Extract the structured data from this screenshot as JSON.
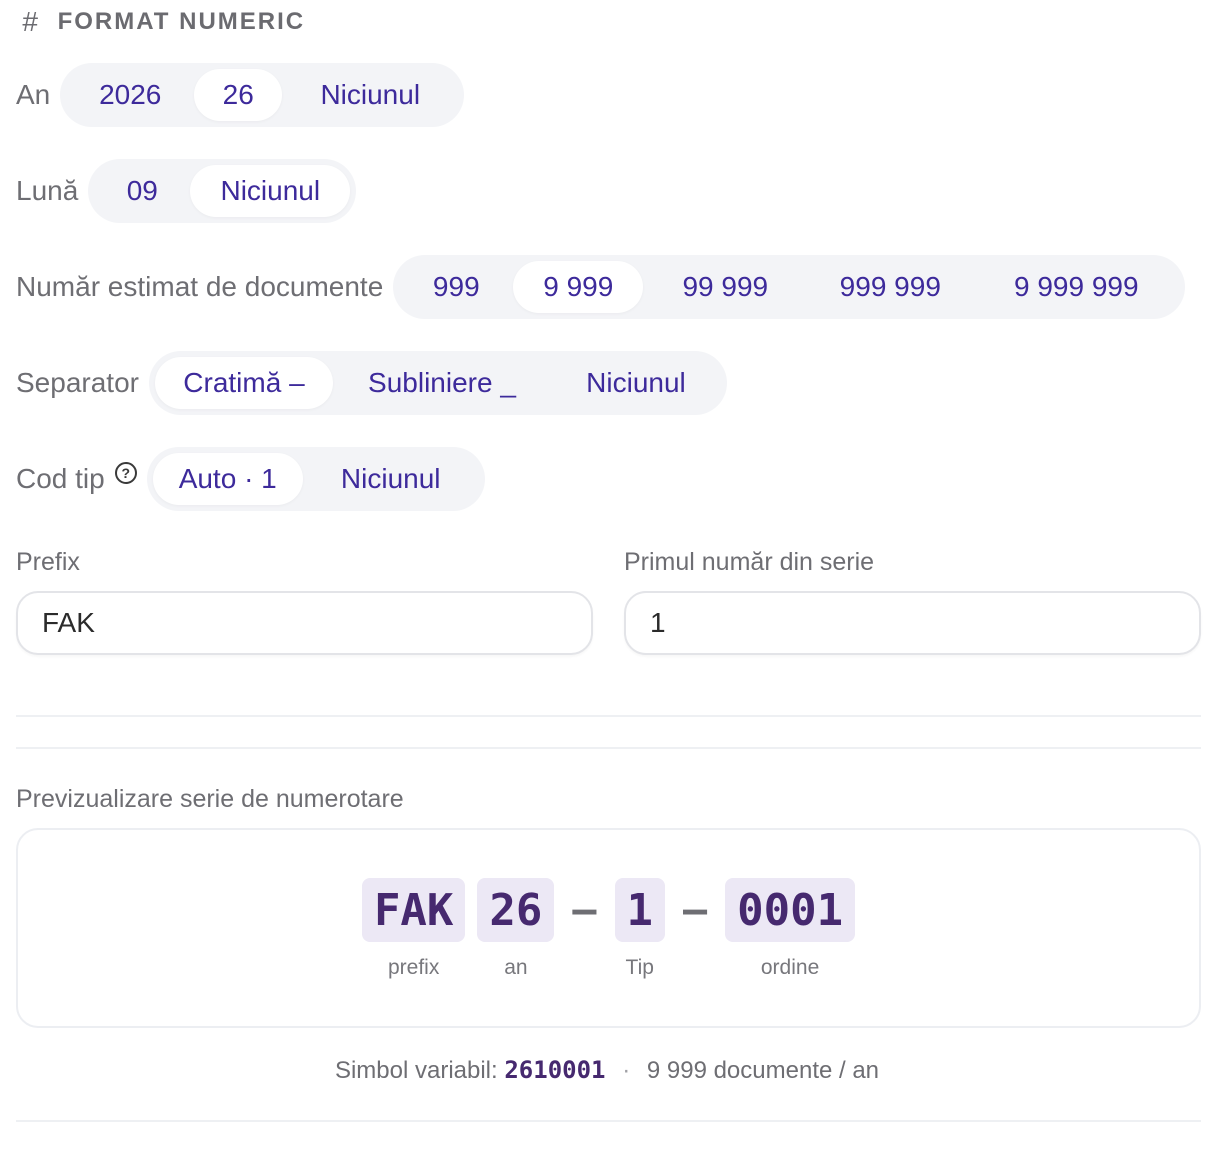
{
  "section": {
    "icon": "hash-icon",
    "glyph": "#",
    "title": "FORMAT NUMERIC"
  },
  "year": {
    "label": "An",
    "options": [
      "2026",
      "26",
      "Niciunul"
    ],
    "selected": "26"
  },
  "month": {
    "label": "Lună",
    "options": [
      "09",
      "Niciunul"
    ],
    "selected": "Niciunul"
  },
  "doc_count": {
    "label": "Număr estimat de documente",
    "options": [
      "999",
      "9 999",
      "99 999",
      "999 999",
      "9 999 999"
    ],
    "selected": "9 999"
  },
  "separator": {
    "label": "Separator",
    "options": [
      "Cratimă –",
      "Subliniere _",
      "Niciunul"
    ],
    "selected": "Cratimă –"
  },
  "type_code": {
    "label": "Cod tip",
    "help_icon": "question-circle-icon",
    "help_glyph": "?",
    "options": [
      "Auto · 1",
      "Niciunul"
    ],
    "selected": "Auto · 1"
  },
  "prefix": {
    "label": "Prefix",
    "value": "FAK"
  },
  "first_number": {
    "label": "Primul număr din serie",
    "value": "1"
  },
  "preview": {
    "label": "Previzualizare serie de numerotare",
    "tokens": [
      {
        "value": "FAK",
        "caption": "prefix"
      },
      {
        "value": "26",
        "caption": "an"
      },
      {
        "value": "–",
        "separator": true
      },
      {
        "value": "1",
        "caption": "Tip"
      },
      {
        "value": "–",
        "separator": true
      },
      {
        "value": "0001",
        "caption": "ordine"
      }
    ]
  },
  "summary": {
    "variable_label": "Simbol variabil:",
    "variable_code": "2610001",
    "dot": "·",
    "capacity": "9 999 documente / an"
  },
  "colors": {
    "accent": "#3d2a9b",
    "token_bg": "#ece8f5",
    "token_text": "#46296f",
    "segment_bg": "#f3f4f7"
  }
}
